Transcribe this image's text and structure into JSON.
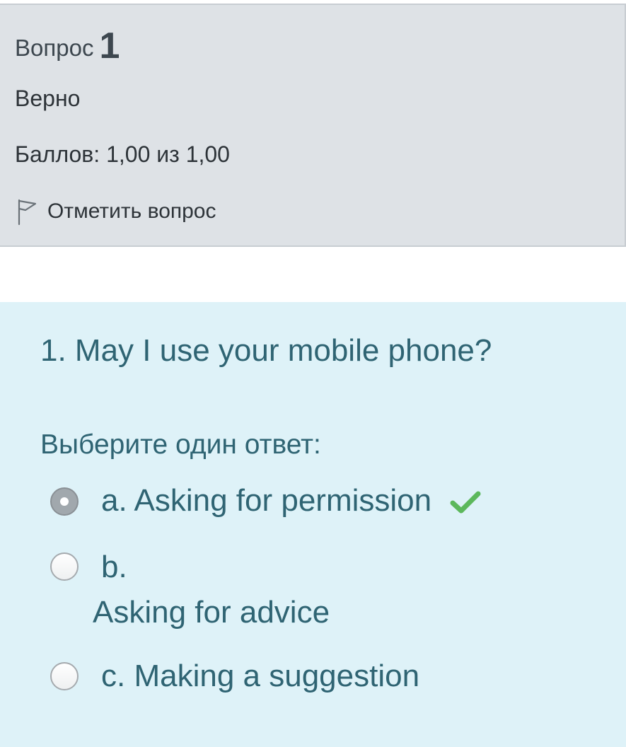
{
  "info": {
    "question_label": "Вопрос",
    "question_number": "1",
    "state": "Верно",
    "grade": "Баллов: 1,00 из 1,00",
    "flag_label": "Отметить вопрос"
  },
  "question": {
    "text": "1. May I use your mobile phone?",
    "prompt": "Выберите один ответ:",
    "options": [
      {
        "prefix": "a.",
        "text": "Asking for permission",
        "selected": true,
        "correct": true
      },
      {
        "prefix": "b.",
        "text": "Asking for advice",
        "selected": false
      },
      {
        "prefix": "c.",
        "text": "Making a suggestion",
        "selected": false
      }
    ]
  },
  "colors": {
    "info_bg": "#dee2e6",
    "content_bg": "#def2f8",
    "text_teal": "#2f6473",
    "correct_green": "#5cb85c"
  },
  "icons": {
    "flag": "flag-icon",
    "correct": "checkmark-icon"
  }
}
